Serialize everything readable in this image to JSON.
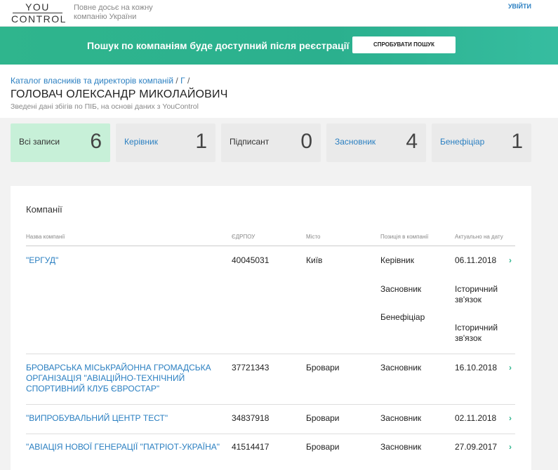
{
  "header": {
    "logo_top": "YOU",
    "logo_bottom": "CONTROL",
    "tagline": "Повне досьє на кожну компанію України",
    "login_label": "УВІЙТИ"
  },
  "banner": {
    "text": "Пошук по компаніям буде доступний після реєстрації",
    "button_label": "СПРОБУВАТИ ПОШУК"
  },
  "breadcrumb": {
    "catalog": "Каталог власників та директорів компаній",
    "separator": "/",
    "letter": "Г",
    "trailing": "/"
  },
  "page": {
    "title": "ГОЛОВАЧ ОЛЕКСАНДР МИКОЛАЙОВИЧ",
    "subtitle": "Зведені дані збігів по ПІБ, на основі даних з YouControl"
  },
  "stats": [
    {
      "label": "Всі записи",
      "count": "6"
    },
    {
      "label": "Керівник",
      "count": "1"
    },
    {
      "label": "Підписант",
      "count": "0"
    },
    {
      "label": "Засновник",
      "count": "4"
    },
    {
      "label": "Бенефіціар",
      "count": "1"
    }
  ],
  "table": {
    "title": "Компанії",
    "headers": {
      "name": "Назва компанії",
      "code": "ЄДРПОУ",
      "city": "Місто",
      "position": "Позиція в компанії",
      "date": "Актуально на дату"
    },
    "rows": [
      {
        "name": "\"ЕРГУД\"",
        "code": "40045031",
        "city": "Київ",
        "positions": [
          "Керівник",
          "Засновник",
          "Бенефіціар"
        ],
        "dates": [
          "06.11.2018",
          "Історичний зв'язок",
          "Історичний зв'язок"
        ]
      },
      {
        "name": "БРОВАРСЬКА МІСЬКРАЙОННА ГРОМАДСЬКА ОРГАНІЗАЦІЯ \"АВІАЦІЙНО-ТЕХНІЧНИЙ СПОРТИВНИЙ КЛУБ ЄВРОСТАР\"",
        "code": "37721343",
        "city": "Бровари",
        "positions": [
          "Засновник"
        ],
        "dates": [
          "16.10.2018"
        ]
      },
      {
        "name": "\"ВИПРОБУВАЛЬНИЙ ЦЕНТР ТЕСТ\"",
        "code": "34837918",
        "city": "Бровари",
        "positions": [
          "Засновник"
        ],
        "dates": [
          "02.11.2018"
        ]
      },
      {
        "name": "\"АВІАЦІЯ НОВОЇ ГЕНЕРАЦІЇ \"ПАТРІОТ-УКРАЇНА\"",
        "code": "41514417",
        "city": "Бровари",
        "positions": [
          "Засновник"
        ],
        "dates": [
          "27.09.2017"
        ]
      }
    ]
  },
  "colors": {
    "accent_green": "#2fb58d",
    "link_blue": "#2a7fc1",
    "active_card": "#c7f0d8"
  },
  "icons": {
    "row_arrow": "chevron-right-icon"
  }
}
